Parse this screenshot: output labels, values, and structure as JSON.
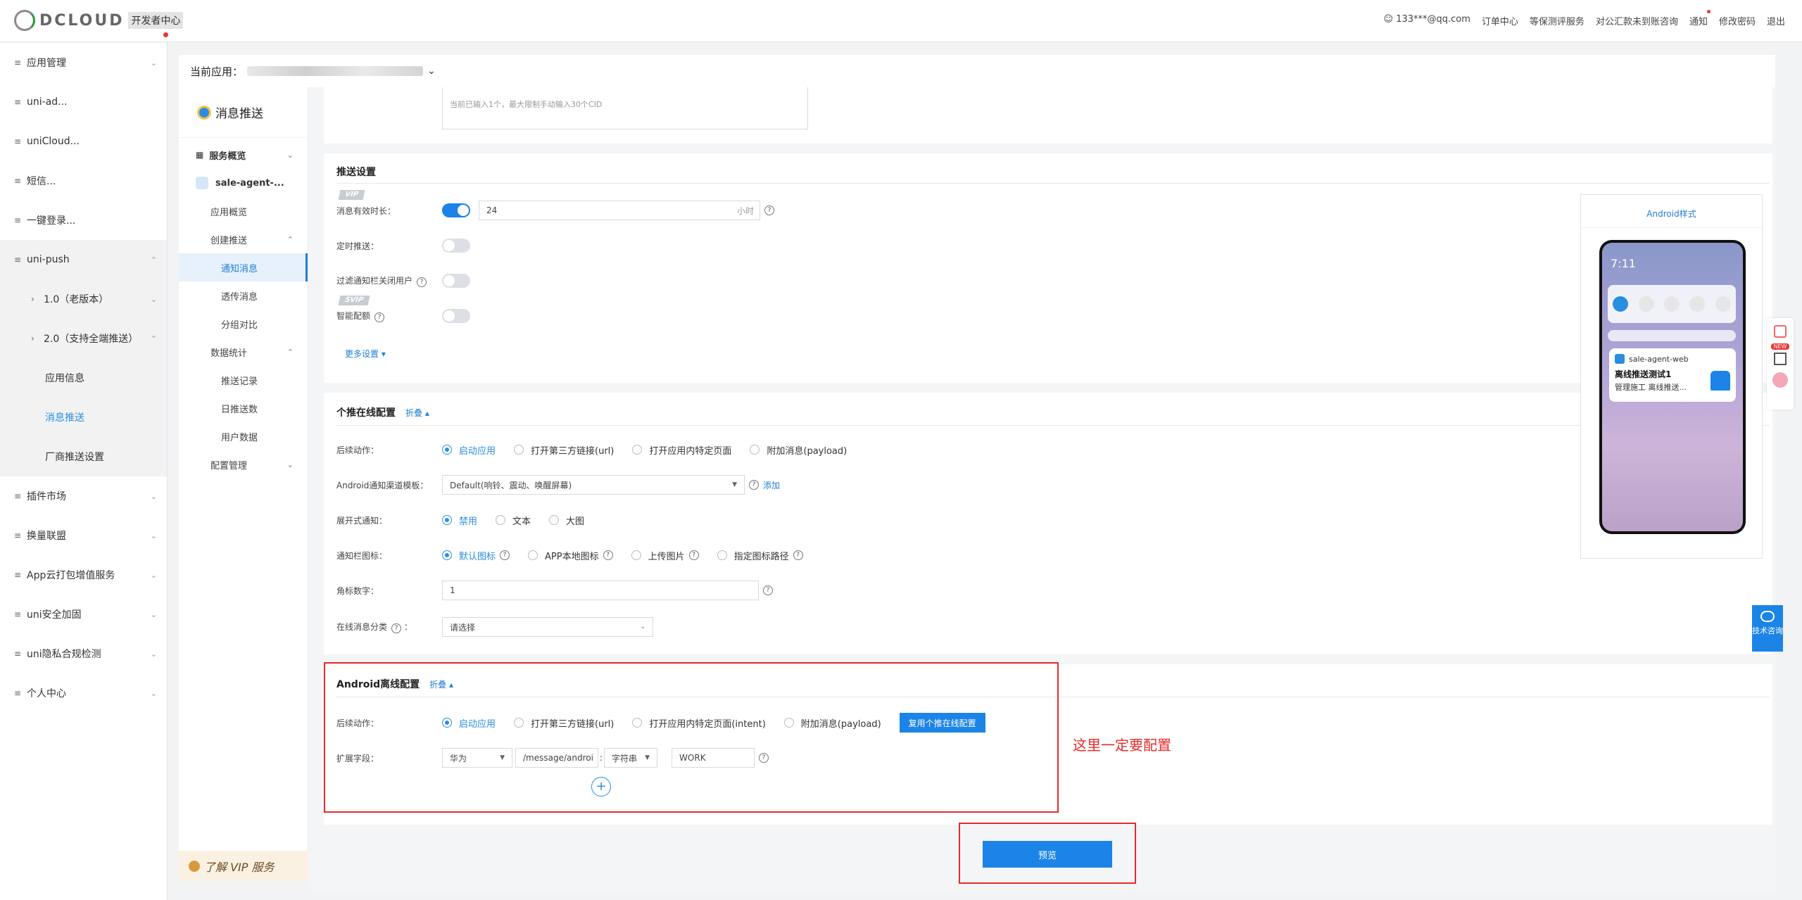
{
  "header": {
    "logo": "DCLOUD",
    "subtitle": "开发者中心",
    "links": [
      "133***@qq.com",
      "订单中心",
      "等保测评服务",
      "对公汇款未到账咨询",
      "通知",
      "修改密码",
      "退出"
    ]
  },
  "nav": {
    "items": [
      "应用管理",
      "uni-ad...",
      "uniCloud...",
      "短信...",
      "一键登录...",
      "uni-push",
      "1.0（老版本）",
      "2.0（支持全端推送）",
      "应用信息",
      "消息推送",
      "厂商推送设置",
      "插件市场",
      "换量联盟",
      "App云打包增值服务",
      "uni安全加固",
      "uni隐私合规检测",
      "个人中心"
    ]
  },
  "app": {
    "label": "当前应用："
  },
  "panel2": {
    "title": "消息推送",
    "items": [
      "服务概览",
      "sale-agent-...",
      "应用概览",
      "创建推送",
      "通知消息",
      "透传消息",
      "分组对比",
      "数据统计",
      "推送记录",
      "日推送数",
      "用户数据",
      "配置管理"
    ],
    "vip": "了解 VIP 服务"
  },
  "cid": {
    "hint": "当前已输入1个，最大限制手动输入30个CID"
  },
  "push": {
    "title": "推送设置",
    "vip": "VIP",
    "svip": "SVIP",
    "ttl_label": "消息有效时长：",
    "ttl_value": "24",
    "ttl_unit": "小时",
    "schedule_label": "定时推送：",
    "filter_label": "过滤通知栏关闭用户",
    "smart_label": "智能配额",
    "more": "更多设置"
  },
  "online": {
    "title": "个推在线配置",
    "fold": "折叠",
    "action_label": "后续动作：",
    "actions": [
      "启动应用",
      "打开第三方链接(url)",
      "打开应用内特定页面",
      "附加消息(payload)"
    ],
    "channel_label": "Android通知渠道模板：",
    "channel_value": "Default(响铃、震动、唤醒屏幕)",
    "add": "添加",
    "expand_label": "展开式通知：",
    "expand_opts": [
      "禁用",
      "文本",
      "大图"
    ],
    "icon_label": "通知栏图标：",
    "icon_opts": [
      "默认图标",
      "APP本地图标",
      "上传图片",
      "指定图标路径"
    ],
    "badge_label": "角标数字：",
    "badge_value": "1",
    "category_label": "在线消息分类",
    "category_placeholder": "请选择"
  },
  "offline": {
    "title": "Android离线配置",
    "fold": "折叠",
    "action_label": "后续动作：",
    "actions": [
      "启动应用",
      "打开第三方链接(url)",
      "打开应用内特定页面(intent)",
      "附加消息(payload)"
    ],
    "reuse": "复用个推在线配置",
    "ext_label": "扩展字段：",
    "ext_vendor": "华为",
    "ext_key": "/message/androi",
    "ext_type": "字符串",
    "ext_value": "WORK",
    "add_icon": "+"
  },
  "annotation": "这里一定要配置",
  "preview_button": "预览",
  "preview": {
    "title": "Android样式",
    "time": "7:11",
    "notif_app": "sale-agent-web",
    "notif_title": "离线推送测试1",
    "notif_body": "管理施工 离线推送..."
  },
  "float": {
    "consult": "技术咨询",
    "new": "NEW"
  }
}
